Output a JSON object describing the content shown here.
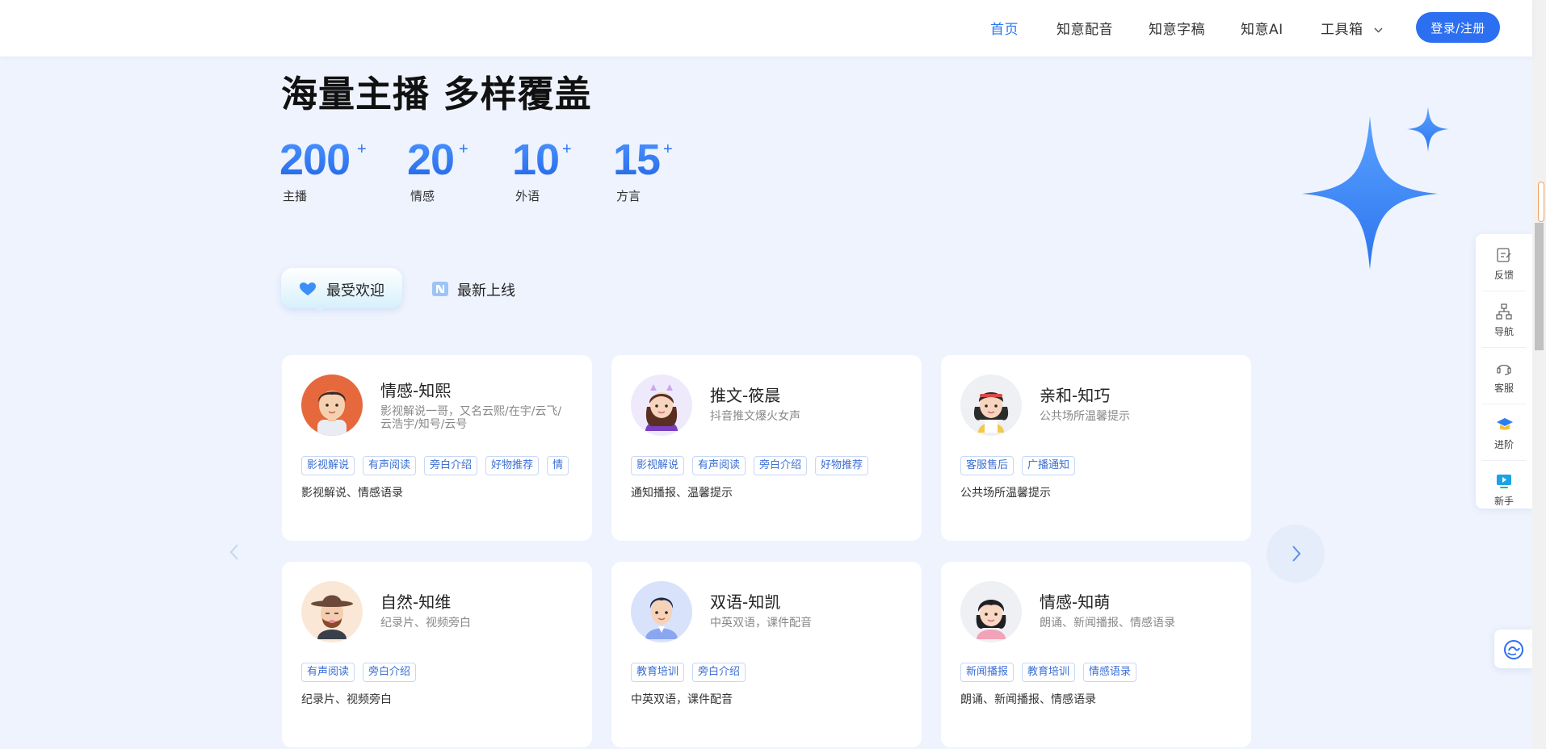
{
  "nav": {
    "items": [
      "首页",
      "知意配音",
      "知意字稿",
      "知意AI",
      "工具箱"
    ],
    "login": "登录/注册"
  },
  "hero": {
    "title": "海量主播 多样覆盖",
    "stats": [
      {
        "value": "200",
        "plus": "+",
        "label": "主播"
      },
      {
        "value": "20",
        "plus": "+",
        "label": "情感"
      },
      {
        "value": "10",
        "plus": "+",
        "label": "外语"
      },
      {
        "value": "15",
        "plus": "+",
        "label": "方言"
      }
    ]
  },
  "tabs": {
    "popular": "最受欢迎",
    "latest": "最新上线"
  },
  "cards": [
    {
      "name": "情感-知熙",
      "desc": "影视解说一哥，又名云熙/在宇/云飞/云浩宇/知号/云号",
      "tags": [
        "影视解说",
        "有声阅读",
        "旁白介绍",
        "好物推荐",
        "情"
      ],
      "note": "影视解说、情感语录"
    },
    {
      "name": "推文-筱晨",
      "desc": "抖音推文爆火女声",
      "tags": [
        "影视解说",
        "有声阅读",
        "旁白介绍",
        "好物推荐"
      ],
      "note": "通知播报、温馨提示"
    },
    {
      "name": "亲和-知巧",
      "desc": "公共场所温馨提示",
      "tags": [
        "客服售后",
        "广播通知"
      ],
      "note": "公共场所温馨提示"
    },
    {
      "name": "自然-知维",
      "desc": "纪录片、视频旁白",
      "tags": [
        "有声阅读",
        "旁白介绍"
      ],
      "note": "纪录片、视频旁白"
    },
    {
      "name": "双语-知凯",
      "desc": "中英双语，课件配音",
      "tags": [
        "教育培训",
        "旁白介绍"
      ],
      "note": "中英双语，课件配音"
    },
    {
      "name": "情感-知萌",
      "desc": "朗诵、新闻播报、情感语录",
      "tags": [
        "新闻播报",
        "教育培训",
        "情感语录"
      ],
      "note": "朗诵、新闻播报、情感语录"
    }
  ],
  "sidebar": [
    "反馈",
    "导航",
    "客服",
    "进阶",
    "新手"
  ],
  "colors": {
    "accent": "#2a78f2",
    "button": "#2c6ff0",
    "background": "#eef3fd",
    "tag_text": "#3b6fd4"
  },
  "icons": [
    "chevron-down-icon",
    "sparkle-star-icon",
    "heart-icon",
    "new-badge-icon",
    "chevron-left-icon",
    "chevron-right-icon",
    "feedback-icon",
    "sitemap-icon",
    "headset-icon",
    "graduation-cap-icon",
    "play-icon",
    "chat-assistant-icon"
  ]
}
